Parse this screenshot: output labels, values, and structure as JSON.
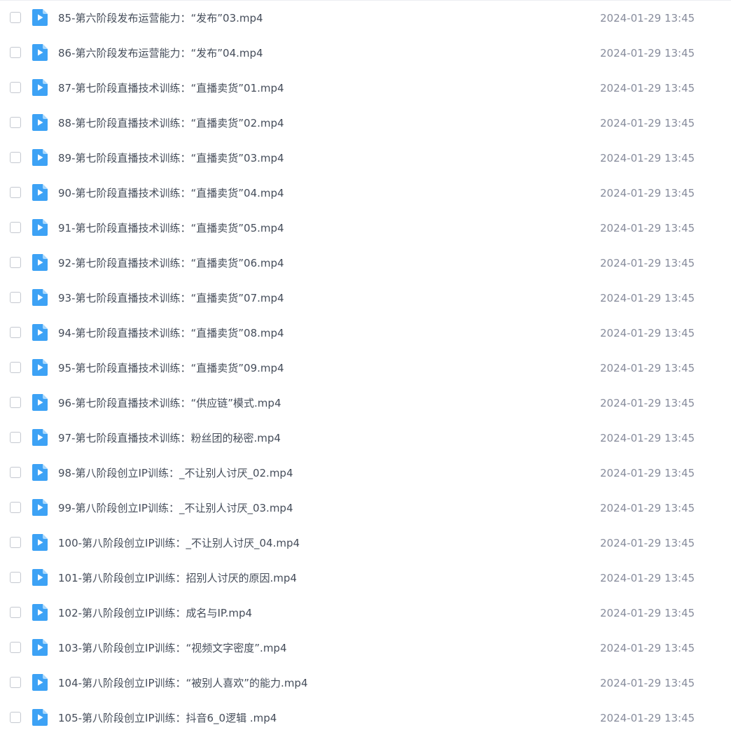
{
  "file_list": {
    "rows": [
      {
        "name": "85-第六阶段发布运营能力：“发布”03.mp4",
        "modified": "2024-01-29 13:45",
        "icon": "video-file-icon"
      },
      {
        "name": "86-第六阶段发布运营能力：“发布”04.mp4",
        "modified": "2024-01-29 13:45",
        "icon": "video-file-icon"
      },
      {
        "name": "87-第七阶段直播技术训练：“直播卖货”01.mp4",
        "modified": "2024-01-29 13:45",
        "icon": "video-file-icon"
      },
      {
        "name": "88-第七阶段直播技术训练：“直播卖货”02.mp4",
        "modified": "2024-01-29 13:45",
        "icon": "video-file-icon"
      },
      {
        "name": "89-第七阶段直播技术训练：“直播卖货”03.mp4",
        "modified": "2024-01-29 13:45",
        "icon": "video-file-icon"
      },
      {
        "name": "90-第七阶段直播技术训练：“直播卖货”04.mp4",
        "modified": "2024-01-29 13:45",
        "icon": "video-file-icon"
      },
      {
        "name": "91-第七阶段直播技术训练：“直播卖货”05.mp4",
        "modified": "2024-01-29 13:45",
        "icon": "video-file-icon"
      },
      {
        "name": "92-第七阶段直播技术训练：“直播卖货”06.mp4",
        "modified": "2024-01-29 13:45",
        "icon": "video-file-icon"
      },
      {
        "name": "93-第七阶段直播技术训练：“直播卖货”07.mp4",
        "modified": "2024-01-29 13:45",
        "icon": "video-file-icon"
      },
      {
        "name": "94-第七阶段直播技术训练：“直播卖货”08.mp4",
        "modified": "2024-01-29 13:45",
        "icon": "video-file-icon"
      },
      {
        "name": "95-第七阶段直播技术训练：“直播卖货”09.mp4",
        "modified": "2024-01-29 13:45",
        "icon": "video-file-icon"
      },
      {
        "name": "96-第七阶段直播技术训练：“供应链”模式.mp4",
        "modified": "2024-01-29 13:45",
        "icon": "video-file-icon"
      },
      {
        "name": "97-第七阶段直播技术训练：粉丝团的秘密.mp4",
        "modified": "2024-01-29 13:45",
        "icon": "video-file-icon"
      },
      {
        "name": "98-第八阶段创立IP训练：_不让别人讨厌_02.mp4",
        "modified": "2024-01-29 13:45",
        "icon": "video-file-icon"
      },
      {
        "name": "99-第八阶段创立IP训练：_不让别人讨厌_03.mp4",
        "modified": "2024-01-29 13:45",
        "icon": "video-file-icon"
      },
      {
        "name": "100-第八阶段创立IP训练：_不让别人讨厌_04.mp4",
        "modified": "2024-01-29 13:45",
        "icon": "video-file-icon"
      },
      {
        "name": "101-第八阶段创立IP训练：招别人讨厌的原因.mp4",
        "modified": "2024-01-29 13:45",
        "icon": "video-file-icon"
      },
      {
        "name": "102-第八阶段创立IP训练：成名与IP.mp4",
        "modified": "2024-01-29 13:45",
        "icon": "video-file-icon"
      },
      {
        "name": "103-第八阶段创立IP训练：“视频文字密度”.mp4",
        "modified": "2024-01-29 13:45",
        "icon": "video-file-icon"
      },
      {
        "name": "104-第八阶段创立IP训练：“被别人喜欢”的能力.mp4",
        "modified": "2024-01-29 13:45",
        "icon": "video-file-icon"
      },
      {
        "name": "105-第八阶段创立IP训练：抖音6_0逻辑 .mp4",
        "modified": "2024-01-29 13:45",
        "icon": "video-file-icon"
      }
    ]
  },
  "colors": {
    "icon_blue": "#3da2f5",
    "icon_fold": "#a9d7fb",
    "name_text": "#454d5a",
    "date_text": "#878c9c",
    "checkbox_border": "#c4c8d0"
  }
}
